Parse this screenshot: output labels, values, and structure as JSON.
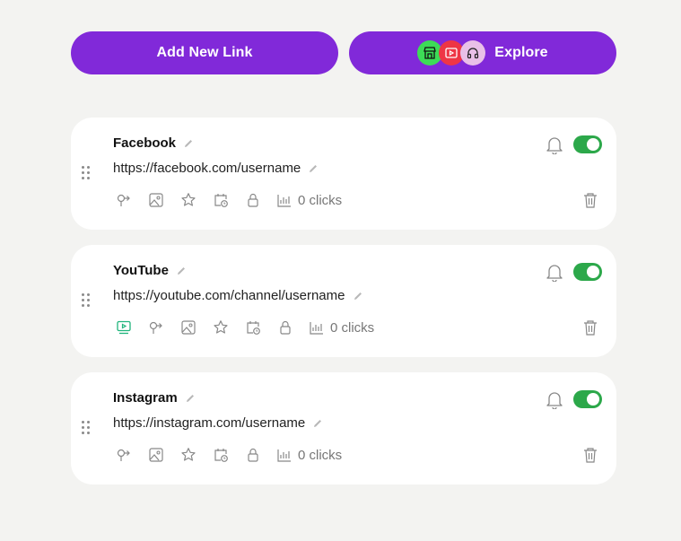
{
  "header": {
    "add_label": "Add New Link",
    "explore_label": "Explore",
    "explore_icon_names": [
      "store-icon",
      "video-icon",
      "headphones-icon"
    ]
  },
  "colors": {
    "accent": "#8129d9",
    "toggle_on": "#2ca84a",
    "icon_green": "#3ddc57",
    "icon_red": "#ee3545",
    "icon_pink": "#e9c0e8",
    "youtube_icon": "#1fb47c"
  },
  "links": [
    {
      "title": "Facebook",
      "url": "https://facebook.com/username",
      "clicks": "0 clicks",
      "enabled": true
    },
    {
      "title": "YouTube",
      "url": "https://youtube.com/channel/username",
      "clicks": "0 clicks",
      "enabled": true
    },
    {
      "title": "Instagram",
      "url": "https://instagram.com/username",
      "clicks": "0 clicks",
      "enabled": true
    }
  ]
}
